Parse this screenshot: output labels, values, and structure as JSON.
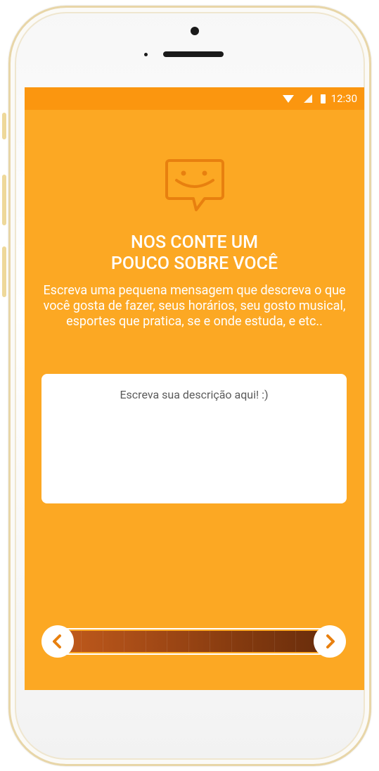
{
  "status_bar": {
    "time": "12:30"
  },
  "onboarding": {
    "title_line1": "NOS CONTE UM",
    "title_line2": "POUCO SOBRE VOCÊ",
    "subtitle": "Escreva uma pequena mensagem que descreva o que você gosta de fazer, seus horários, seu gosto musical, esportes que pratica, se e onde estuda, e etc..",
    "description_placeholder": "Escreva sua descrição aqui! :)",
    "icon": "chat-smile-icon"
  },
  "progress": {
    "value_percent": 95,
    "prev_icon": "chevron-left-icon",
    "next_icon": "chevron-right-icon"
  },
  "colors": {
    "background": "#fca823",
    "status_bar": "#fb960f",
    "accent_dark": "#e8800f",
    "progress_dark": "#6b2e0c"
  }
}
